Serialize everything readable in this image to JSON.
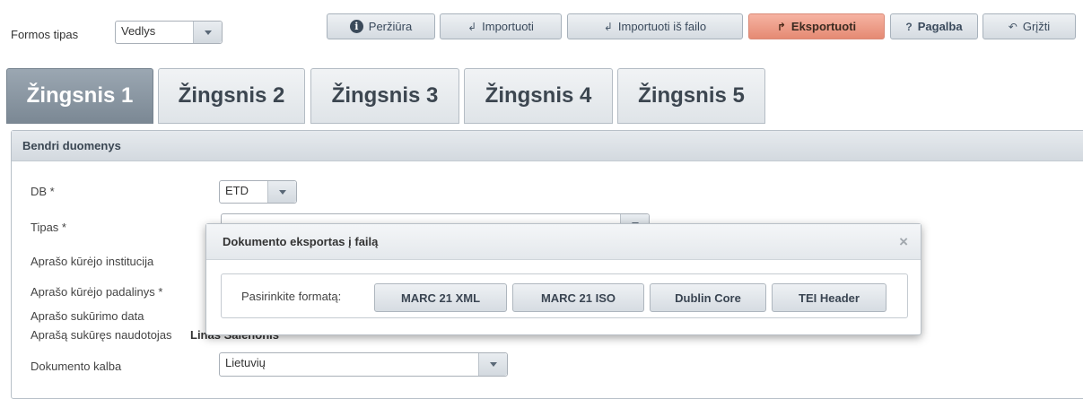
{
  "toolbar": {
    "form_type_label": "Formos tipas",
    "form_type_value": "Vedlys",
    "buttons": {
      "preview": "Peržiūra",
      "import": "Importuoti",
      "import_file": "Importuoti iš failo",
      "export": "Eksportuoti",
      "help": "Pagalba",
      "back": "Grįžti"
    },
    "icons": {
      "preview": "i",
      "import": "↲",
      "import_file": "↲",
      "export": "↱",
      "help": "?",
      "back": "↶"
    }
  },
  "steps": [
    "Žingsnis 1",
    "Žingsnis 2",
    "Žingsnis 3",
    "Žingsnis 4",
    "Žingsnis 5"
  ],
  "panel": {
    "title": "Bendri duomenys",
    "fields": {
      "db_label": "DB *",
      "db_value": "ETD",
      "type_label": "Tipas *",
      "institution_label": "Aprašo kūrėjo institucija",
      "unit_label": "Aprašo kūrėjo padalinys *",
      "created_label": "Aprašo sukūrimo data",
      "creator_label": "Aprašą sukūręs naudotojas",
      "creator_value": "Linas Šalenonis",
      "language_label": "Dokumento kalba",
      "language_value": "Lietuvių"
    }
  },
  "modal": {
    "title": "Dokumento eksportas į failą",
    "close": "×",
    "format_label": "Pasirinkite formatą:",
    "formats": [
      "MARC 21 XML",
      "MARC 21 ISO",
      "Dublin Core",
      "TEI Header"
    ]
  },
  "colors": {
    "export_button": "#e58a73",
    "active_step": "#8a96a2"
  }
}
